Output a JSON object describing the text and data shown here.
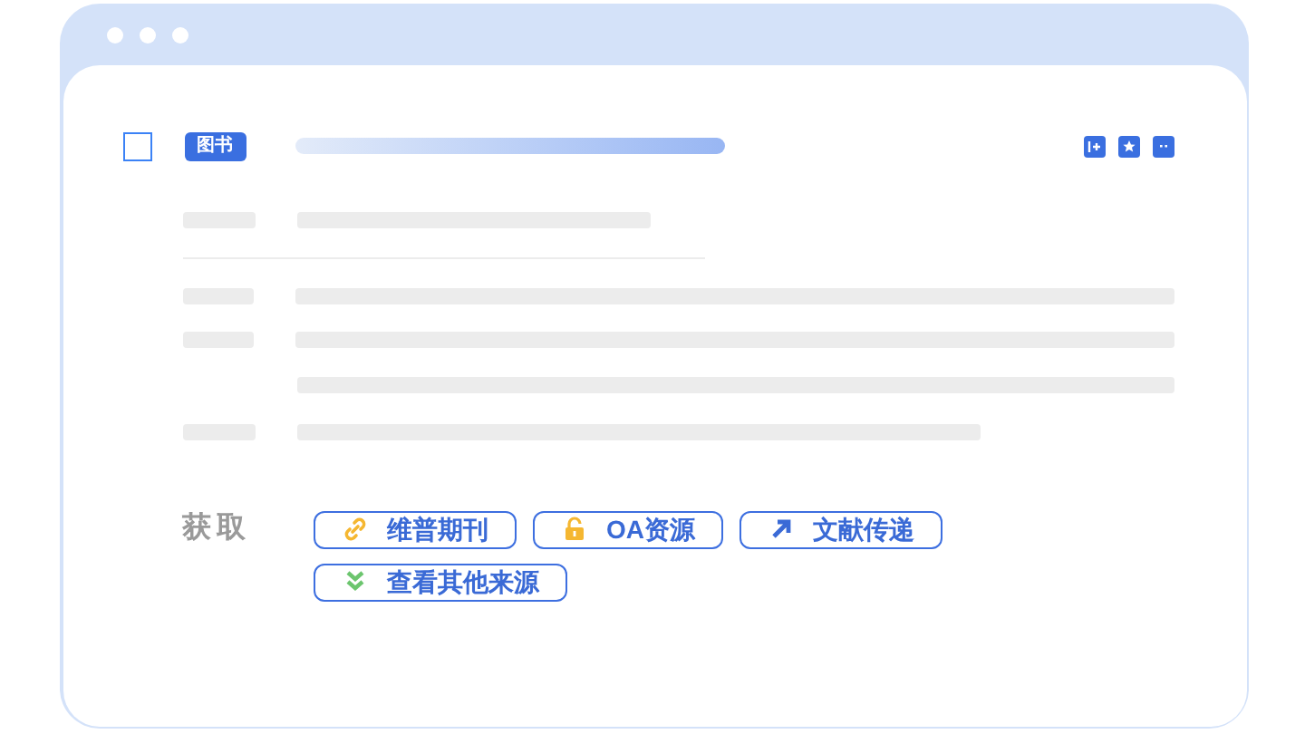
{
  "record": {
    "checked": false,
    "type_badge": "图书"
  },
  "acquire": {
    "label": "获取",
    "sources": [
      {
        "kind": "link",
        "label": "维普期刊"
      },
      {
        "kind": "unlock",
        "label": "OA资源"
      },
      {
        "kind": "arrow",
        "label": "文献传递"
      },
      {
        "kind": "more",
        "label": "查看其他来源"
      }
    ]
  }
}
